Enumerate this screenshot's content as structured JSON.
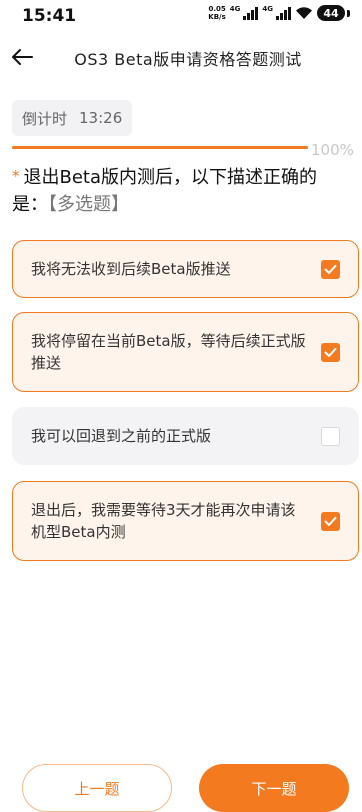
{
  "status_bar": {
    "time": "15:41",
    "net_speed_value": "0.05",
    "net_speed_unit": "KB/s",
    "sim1": "4G",
    "sim2": "4G",
    "battery": "44"
  },
  "header": {
    "title": "OS3 Beta版申请资格答题测试",
    "back_icon": "arrow-left-icon"
  },
  "countdown": {
    "label": "倒计时",
    "value": "13:26"
  },
  "progress": {
    "percent": 100,
    "label": "100%"
  },
  "question": {
    "required_mark": "*",
    "text": "退出Beta版内测后，以下描述正确的是：",
    "type_label": "【多选题】"
  },
  "options": [
    {
      "text": "我将无法收到后续Beta版推送",
      "checked": true
    },
    {
      "text": "我将停留在当前Beta版，等待后续正式版推送",
      "checked": true
    },
    {
      "text": "我可以回退到之前的正式版",
      "checked": false
    },
    {
      "text": "退出后，我需要等待3天才能再次申请该机型Beta内测",
      "checked": true
    }
  ],
  "footer": {
    "prev_label": "上一题",
    "next_label": "下一题"
  },
  "colors": {
    "accent": "#f47a1f",
    "checked_bg": "#fff4eb",
    "unchecked_bg": "#f3f3f5"
  }
}
